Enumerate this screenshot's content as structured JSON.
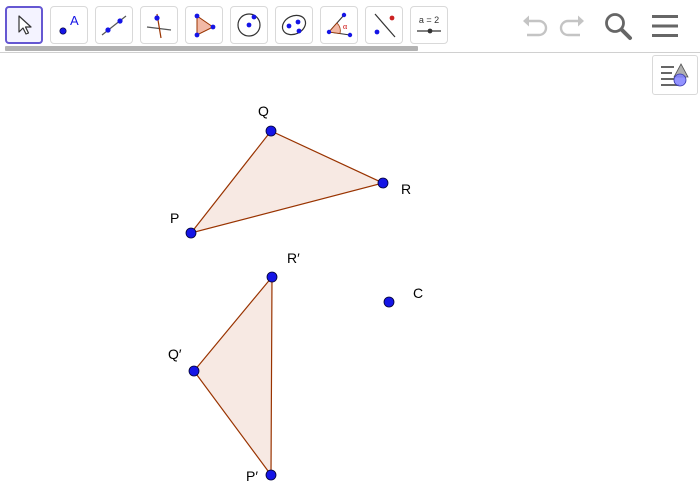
{
  "toolbar": {
    "tools": [
      {
        "name": "move",
        "icon": "arrow-cursor-icon"
      },
      {
        "name": "point",
        "icon": "point-icon",
        "label": "A"
      },
      {
        "name": "line",
        "icon": "line-icon"
      },
      {
        "name": "perpendicular-line",
        "icon": "perpendicular-line-icon"
      },
      {
        "name": "polygon",
        "icon": "polygon-icon"
      },
      {
        "name": "circle-center-point",
        "icon": "circle-icon"
      },
      {
        "name": "ellipse",
        "icon": "ellipse-icon"
      },
      {
        "name": "angle",
        "icon": "angle-icon",
        "label": "α"
      },
      {
        "name": "reflect",
        "icon": "reflect-line-icon"
      },
      {
        "name": "slider",
        "icon": "slider-icon",
        "label": "a = 2"
      }
    ],
    "selected_tool": "move",
    "actions": [
      "undo-icon",
      "redo-icon",
      "search-icon",
      "menu-icon"
    ]
  },
  "colors": {
    "point": "#1515e6",
    "edge": "#993300",
    "fill": "#f7e9e3",
    "selected_border": "#6557d2",
    "icon_gray": "#666666",
    "icon_disabled": "#c4c4c4"
  },
  "geometry": {
    "points": [
      {
        "id": "P",
        "label": "P"
      },
      {
        "id": "Q",
        "label": "Q"
      },
      {
        "id": "R",
        "label": "R"
      },
      {
        "id": "Pp",
        "label": "P′"
      },
      {
        "id": "Qp",
        "label": "Q′"
      },
      {
        "id": "Rp",
        "label": "R′"
      },
      {
        "id": "C",
        "label": "C"
      }
    ],
    "polygons": [
      {
        "id": "triangle-PQR",
        "vertices": [
          "P",
          "Q",
          "R"
        ]
      },
      {
        "id": "triangle-PpQpRp",
        "vertices": [
          "Pp",
          "Qp",
          "Rp"
        ]
      }
    ]
  }
}
